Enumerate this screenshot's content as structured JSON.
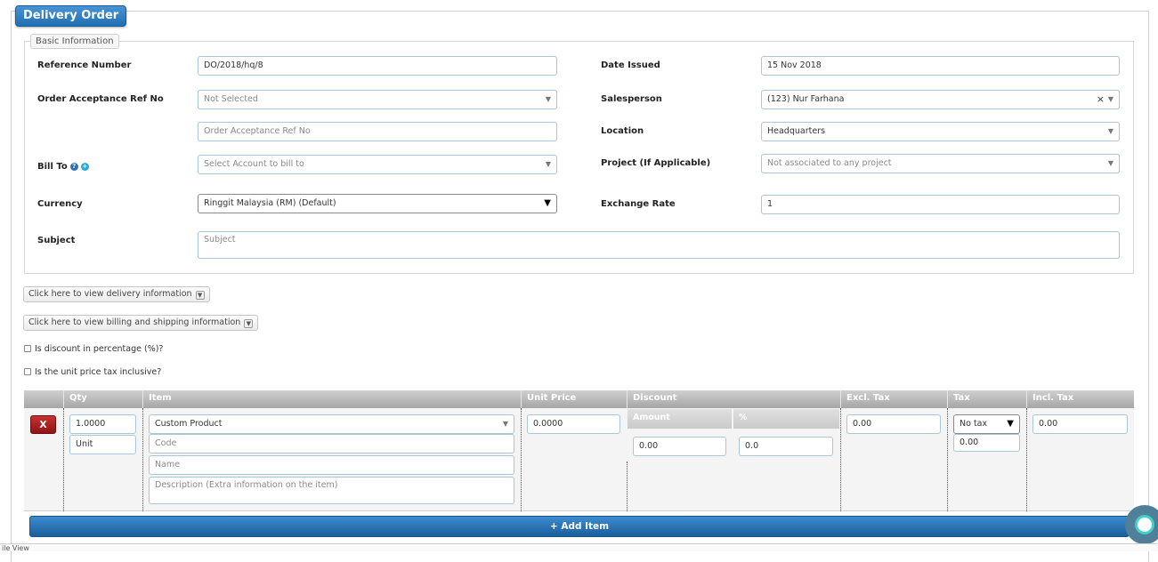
{
  "title": "Delivery Order",
  "basic_info": {
    "legend": "Basic Information",
    "reference_number": {
      "label": "Reference Number",
      "value": "DO/2018/hq/8"
    },
    "date_issued": {
      "label": "Date Issued",
      "value": "15 Nov 2018"
    },
    "order_acceptance": {
      "label": "Order Acceptance Ref No",
      "placeholder": "Not Selected",
      "ref_placeholder": "Order Acceptance Ref No"
    },
    "salesperson": {
      "label": "Salesperson",
      "value": "(123) Nur Farhana"
    },
    "location": {
      "label": "Location",
      "value": "Headquarters"
    },
    "bill_to": {
      "label": "Bill To",
      "placeholder": "Select Account to bill to"
    },
    "project": {
      "label": "Project (If Applicable)",
      "placeholder": "Not associated to any project"
    },
    "currency": {
      "label": "Currency",
      "value": "Ringgit Malaysia (RM) (Default)"
    },
    "exchange_rate": {
      "label": "Exchange Rate",
      "value": "1"
    },
    "subject": {
      "label": "Subject",
      "placeholder": "Subject"
    }
  },
  "toggles": {
    "delivery": "Click here to view delivery information",
    "billing": "Click here to view billing and shipping information"
  },
  "options": {
    "discount_pct": "Is discount in percentage (%)?",
    "tax_inclusive": "Is the unit price tax inclusive?"
  },
  "items_table": {
    "headers": {
      "qty": "Qty",
      "item": "Item",
      "unit_price": "Unit Price",
      "discount": "Discount",
      "excl_tax": "Excl. Tax",
      "tax": "Tax",
      "incl_tax": "Incl. Tax"
    },
    "discount_sub": {
      "amount": "Amount",
      "pct": "%"
    },
    "row": {
      "delete_label": "X",
      "qty": "1.0000",
      "unit": "Unit",
      "item": "Custom Product",
      "code_placeholder": "Code",
      "name_placeholder": "Name",
      "desc_placeholder": "Description (Extra information on the item)",
      "unit_price": "0.0000",
      "discount_amount": "0.00",
      "discount_pct": "0.0",
      "excl_tax": "0.00",
      "tax": "No tax",
      "tax_amount": "0.00",
      "incl_tax": "0.00"
    }
  },
  "add_item_label": "+ Add Item",
  "footer_text": "ile View",
  "colors": {
    "primary": "#1f6fb3",
    "danger": "#a51c1c",
    "header_gray": "#a6a6a6"
  }
}
